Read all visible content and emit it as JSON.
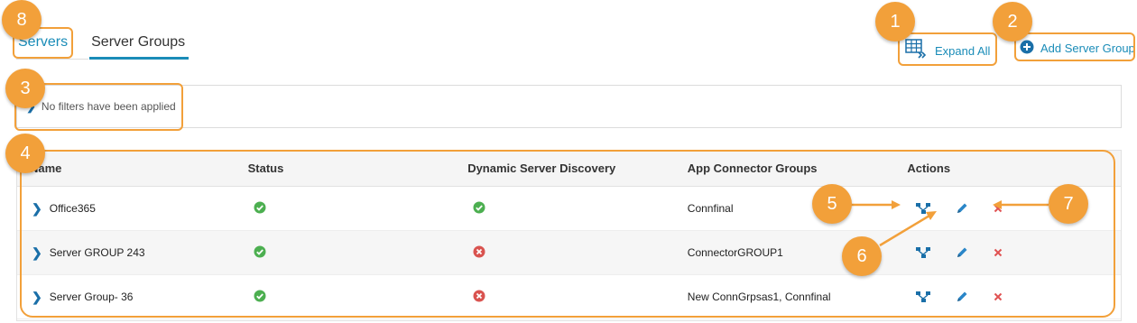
{
  "tabs": {
    "servers": "Servers",
    "server_groups": "Server Groups"
  },
  "toolbar": {
    "expand_all": "Expand All",
    "add_server_group": "Add Server Group"
  },
  "filters": {
    "text": "No filters have been applied"
  },
  "table": {
    "columns": [
      "Name",
      "Status",
      "Dynamic Server Discovery",
      "App Connector Groups",
      "Actions"
    ],
    "rows": [
      {
        "name": "Office365",
        "status": "ok",
        "discovery": "ok",
        "connector_groups": "Connfinal"
      },
      {
        "name": "Server GROUP 243",
        "status": "ok",
        "discovery": "error",
        "connector_groups": "ConnectorGROUP1"
      },
      {
        "name": "Server Group- 36",
        "status": "ok",
        "discovery": "error",
        "connector_groups": "New ConnGrpsas1, Connfinal"
      }
    ]
  },
  "callouts": {
    "c1": "1",
    "c2": "2",
    "c3": "3",
    "c4": "4",
    "c5": "5",
    "c6": "6",
    "c7": "7",
    "c8": "8"
  },
  "colors": {
    "accent": "#1a8cb8",
    "callout": "#f2a03a",
    "ok": "#4caf50",
    "error": "#d9534f"
  }
}
